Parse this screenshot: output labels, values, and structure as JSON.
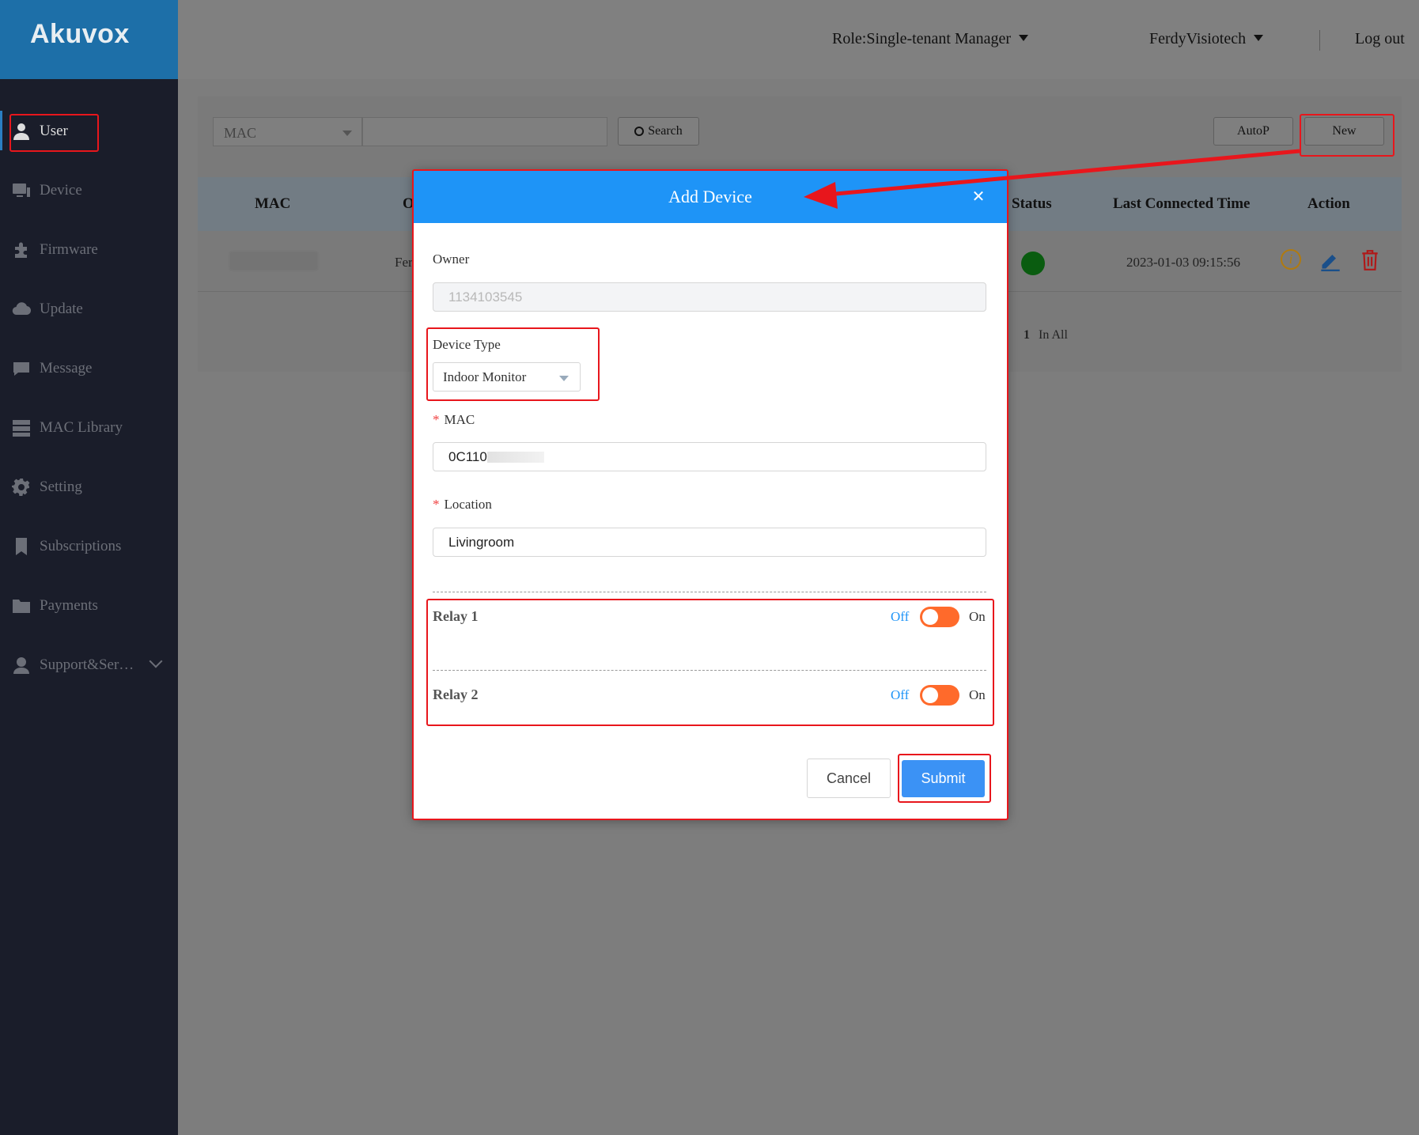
{
  "app": {
    "logo": "Akuvox"
  },
  "topbar": {
    "role": "Role:Single-tenant Manager",
    "user": "FerdyVisiotech",
    "logout": "Log out"
  },
  "sidebar": {
    "items": [
      {
        "label": "User",
        "icon": "user-icon"
      },
      {
        "label": "Device",
        "icon": "device-icon"
      },
      {
        "label": "Firmware",
        "icon": "puzzle-icon"
      },
      {
        "label": "Update",
        "icon": "cloud-upload-icon"
      },
      {
        "label": "Message",
        "icon": "message-icon"
      },
      {
        "label": "MAC Library",
        "icon": "server-icon"
      },
      {
        "label": "Setting",
        "icon": "gear-icon"
      },
      {
        "label": "Subscriptions",
        "icon": "bookmark-icon"
      },
      {
        "label": "Payments",
        "icon": "folder-icon"
      },
      {
        "label": "Support&Ser…",
        "icon": "support-icon"
      }
    ]
  },
  "search": {
    "filter_value": "MAC",
    "search_label": "Search",
    "autop_label": "AutoP",
    "new_label": "New"
  },
  "table": {
    "headers": [
      "MAC",
      "O",
      "Status",
      "Last Connected Time",
      "Action"
    ],
    "rows": [
      {
        "owner_partial": "Fer",
        "last_connected": "2023-01-03 09:15:56"
      }
    ],
    "pagination": {
      "count": "1",
      "label": "In All"
    }
  },
  "modal": {
    "title": "Add Device",
    "owner_label": "Owner",
    "owner_value": "1134103545",
    "device_type_label": "Device Type",
    "device_type_value": "Indoor Monitor",
    "mac_label": "MAC",
    "mac_value": "0C110",
    "location_label": "Location",
    "location_value": "Livingroom",
    "relays": [
      {
        "label": "Relay 1",
        "off": "Off",
        "on": "On"
      },
      {
        "label": "Relay 2",
        "off": "Off",
        "on": "On"
      }
    ],
    "cancel_label": "Cancel",
    "submit_label": "Submit",
    "required_mark": "*"
  },
  "colors": {
    "accent": "#1e94f7",
    "annotation": "#e8161c",
    "toggle": "#ff6a2b",
    "sidebar": "#1a1d2a"
  }
}
